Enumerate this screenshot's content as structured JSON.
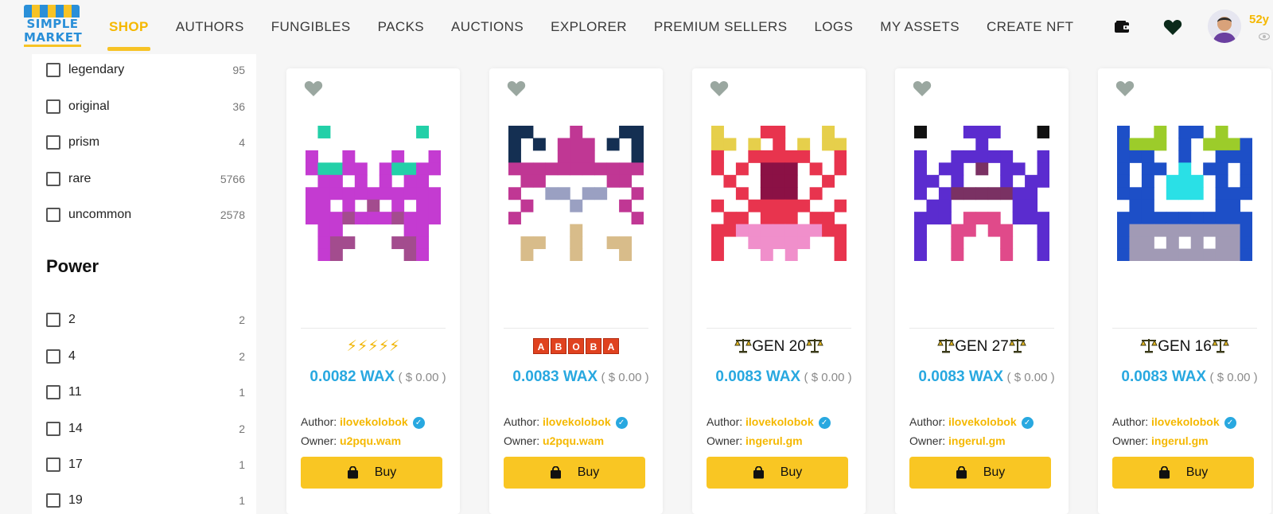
{
  "header": {
    "logo_line1": "SIMPLE",
    "logo_line2": "MARKET",
    "nav": [
      "SHOP",
      "AUTHORS",
      "FUNGIBLES",
      "PACKS",
      "AUCTIONS",
      "EXPLORER",
      "PREMIUM SELLERS",
      "LOGS",
      "MY ASSETS",
      "CREATE NFT"
    ],
    "active_nav": "SHOP",
    "user_name": "52y",
    "icons": [
      "wallet-icon",
      "heart-icon",
      "avatar",
      "eye-icon"
    ]
  },
  "sidebar": {
    "rarity_filters": [
      {
        "label": "legendary",
        "count": "95"
      },
      {
        "label": "original",
        "count": "36"
      },
      {
        "label": "prism",
        "count": "4"
      },
      {
        "label": "rare",
        "count": "5766"
      },
      {
        "label": "uncommon",
        "count": "2578"
      }
    ],
    "power_title": "Power",
    "power_filters": [
      {
        "label": "2",
        "count": "2"
      },
      {
        "label": "4",
        "count": "2"
      },
      {
        "label": "11",
        "count": "1"
      },
      {
        "label": "14",
        "count": "2"
      },
      {
        "label": "17",
        "count": "1"
      },
      {
        "label": "19",
        "count": "1"
      }
    ]
  },
  "cards": [
    {
      "title_type": "bolts",
      "title": "⚡⚡⚡⚡⚡",
      "price": "0.0082 WAX",
      "usd": "( $ 0.00 )",
      "author_label": "Author:",
      "author": "ilovekolobok",
      "owner_label": "Owner:",
      "owner": "u2pqu.wam",
      "buy_label": "Buy"
    },
    {
      "title_type": "aboba",
      "title": [
        "A",
        "B",
        "O",
        "B",
        "A"
      ],
      "price": "0.0083 WAX",
      "usd": "( $ 0.00 )",
      "author_label": "Author:",
      "author": "ilovekolobok",
      "owner_label": "Owner:",
      "owner": "u2pqu.wam",
      "buy_label": "Buy"
    },
    {
      "title_type": "gen",
      "title": "GEN 20",
      "price": "0.0083 WAX",
      "usd": "( $ 0.00 )",
      "author_label": "Author:",
      "author": "ilovekolobok",
      "owner_label": "Owner:",
      "owner": "ingerul.gm",
      "buy_label": "Buy"
    },
    {
      "title_type": "gen",
      "title": "GEN 27",
      "price": "0.0083 WAX",
      "usd": "( $ 0.00 )",
      "author_label": "Author:",
      "author": "ilovekolobok",
      "owner_label": "Owner:",
      "owner": "ingerul.gm",
      "buy_label": "Buy"
    },
    {
      "title_type": "gen",
      "title": "GEN 16",
      "price": "0.0083 WAX",
      "usd": "( $ 0.00 )",
      "author_label": "Author:",
      "author": "ilovekolobok",
      "owner_label": "Owner:",
      "owner": "ingerul.gm",
      "buy_label": "Buy"
    }
  ],
  "colors": {
    "accent_yellow": "#f9c623",
    "price_blue": "#28a8e0",
    "owner_gold": "#f5b800"
  }
}
